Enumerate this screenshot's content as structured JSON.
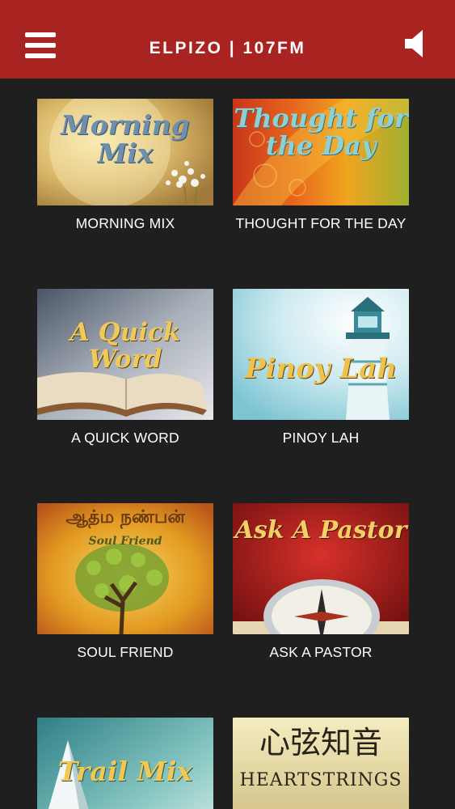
{
  "header": {
    "title": "ELPIZO | 107FM",
    "background": "#a92421",
    "menu_icon": "hamburger-menu-icon",
    "sound_icon": "speaker-icon"
  },
  "programs": [
    {
      "label": "MORNING MIX",
      "art_text": [
        "Morning",
        "Mix"
      ]
    },
    {
      "label": "THOUGHT FOR THE DAY",
      "art_text": [
        "Thought for",
        "the Day"
      ]
    },
    {
      "label": "A QUICK WORD",
      "art_text": [
        "A Quick Word"
      ]
    },
    {
      "label": "PINOY LAH",
      "art_text": [
        "Pinoy Lah"
      ]
    },
    {
      "label": "SOUL FRIEND",
      "art_text": [
        "ஆத்ம நண்பன்",
        "Soul Friend"
      ]
    },
    {
      "label": "ASK A PASTOR",
      "art_text": [
        "Ask A Pastor"
      ]
    },
    {
      "label": "",
      "art_text": [
        "Trail Mix"
      ]
    },
    {
      "label": "",
      "art_text": [
        "心弦知音",
        "HEARTSTRINGS"
      ]
    }
  ]
}
